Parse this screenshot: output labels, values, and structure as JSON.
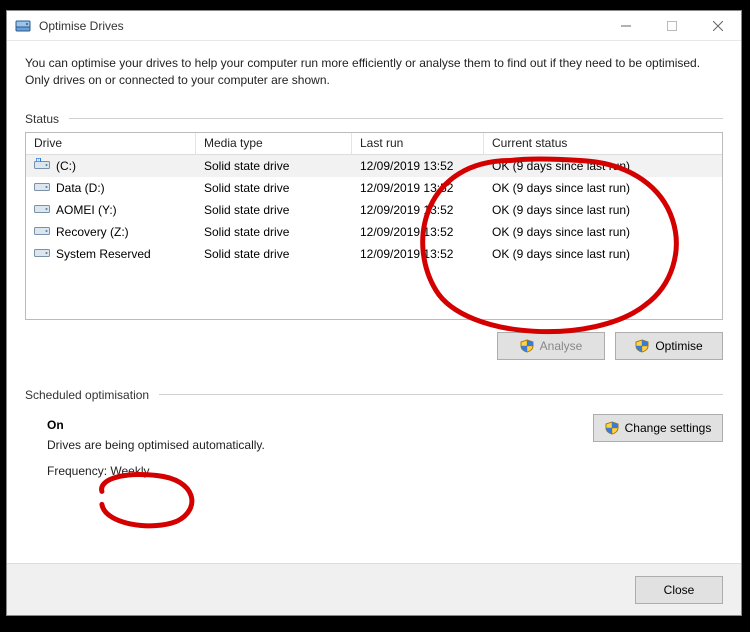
{
  "window": {
    "title": "Optimise Drives"
  },
  "description": "You can optimise your drives to help your computer run more efficiently or analyse them to find out if they need to be optimised. Only drives on or connected to your computer are shown.",
  "status_label": "Status",
  "columns": {
    "drive": "Drive",
    "media": "Media type",
    "last": "Last run",
    "status": "Current status"
  },
  "drives": [
    {
      "name": "(C:)",
      "media": "Solid state drive",
      "last": "12/09/2019 13:52",
      "status": "OK (9 days since last run)",
      "selected": true,
      "os": true
    },
    {
      "name": "Data (D:)",
      "media": "Solid state drive",
      "last": "12/09/2019 13:52",
      "status": "OK (9 days since last run)",
      "selected": false,
      "os": false
    },
    {
      "name": "AOMEI (Y:)",
      "media": "Solid state drive",
      "last": "12/09/2019 13:52",
      "status": "OK (9 days since last run)",
      "selected": false,
      "os": false
    },
    {
      "name": "Recovery (Z:)",
      "media": "Solid state drive",
      "last": "12/09/2019 13:52",
      "status": "OK (9 days since last run)",
      "selected": false,
      "os": false
    },
    {
      "name": "System Reserved",
      "media": "Solid state drive",
      "last": "12/09/2019 13:52",
      "status": "OK (9 days since last run)",
      "selected": false,
      "os": false
    }
  ],
  "buttons": {
    "analyse": "Analyse",
    "optimise": "Optimise",
    "change_settings": "Change settings",
    "close": "Close"
  },
  "scheduled": {
    "label": "Scheduled optimisation",
    "state": "On",
    "desc": "Drives are being optimised automatically.",
    "frequency_label": "Frequency:",
    "frequency_value": "Weekly"
  }
}
